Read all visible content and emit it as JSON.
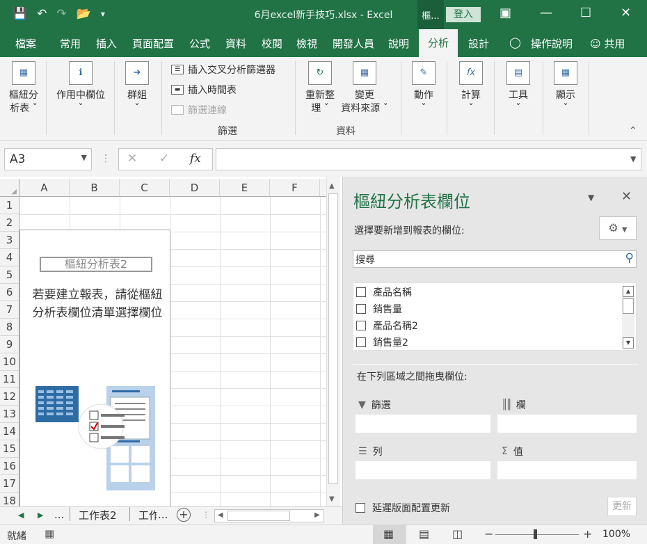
{
  "window": {
    "title": "6月excel新手技巧.xlsx  -  Excel",
    "context_group": "樞...",
    "login_label": "登入"
  },
  "tabs": [
    {
      "label": "檔案"
    },
    {
      "label": "常用"
    },
    {
      "label": "插入"
    },
    {
      "label": "頁面配置"
    },
    {
      "label": "公式"
    },
    {
      "label": "資料"
    },
    {
      "label": "校閱"
    },
    {
      "label": "檢視"
    },
    {
      "label": "開發人員"
    },
    {
      "label": "說明"
    },
    {
      "label": "分析",
      "active": true
    },
    {
      "label": "設計"
    }
  ],
  "tell_me": "操作說明",
  "share": "共用",
  "ribbon": {
    "pivot_table_line1": "樞紐分",
    "pivot_table_line2": "析表 ˇ",
    "active_field_line1": "作用中欄位",
    "active_field_line2": "ˇ",
    "group_line1": "群組",
    "group_line2": "ˇ",
    "insert_slicer": "插入交叉分析篩選器",
    "insert_timeline": "插入時間表",
    "filter_connections": "篩選連線",
    "filter_group_label": "篩選",
    "refresh_line1": "重新整",
    "refresh_line2": "理 ˇ",
    "change_source_line1": "變更",
    "change_source_line2": "資料來源 ˇ",
    "data_group_label": "資料",
    "actions_line1": "動作",
    "actions_line2": "ˇ",
    "calculations_line1": "計算",
    "calculations_line2": "ˇ",
    "tools_line1": "工具",
    "tools_line2": "ˇ",
    "show_line1": "顯示",
    "show_line2": "ˇ"
  },
  "formula_bar": {
    "name_box": "A3",
    "fx": "fx",
    "formula": ""
  },
  "grid": {
    "columns": [
      "A",
      "B",
      "C",
      "D",
      "E",
      "F"
    ],
    "rows": [
      "1",
      "2",
      "3",
      "4",
      "5",
      "6",
      "7",
      "8",
      "9",
      "10",
      "11",
      "12",
      "13",
      "14",
      "15",
      "16",
      "17",
      "18"
    ],
    "pivot_name": "樞紐分析表2",
    "pivot_msg_line1": "若要建立報表，請從樞紐",
    "pivot_msg_line2": "分析表欄位清單選擇欄位"
  },
  "sheet_tabs": {
    "ellipsis_left": "...",
    "sheet1": "工作表2",
    "sheet2": "工作",
    "ellipsis_right": "..."
  },
  "pane": {
    "title": "樞紐分析表欄位",
    "choose_label": "選擇要新增到報表的欄位:",
    "search_placeholder": "搜尋",
    "fields": [
      {
        "label": "產品名稱",
        "checked": false
      },
      {
        "label": "銷售量",
        "checked": false
      },
      {
        "label": "產品名稱2",
        "checked": false
      },
      {
        "label": "銷售量2",
        "checked": false
      }
    ],
    "drag_label": "在下列區域之間拖曳欄位:",
    "zone_filters": "篩選",
    "zone_columns": "欄",
    "zone_rows": "列",
    "zone_values": "值",
    "defer_label": "延遲版面配置更新",
    "update_button": "更新"
  },
  "status": {
    "ready": "就緒",
    "zoom_minus": "−",
    "zoom_plus": "+",
    "zoom": "100%"
  },
  "colors": {
    "excel_green": "#217346",
    "ribbon_bg": "#f3f3f3",
    "pane_bg": "#e6e6e6"
  }
}
